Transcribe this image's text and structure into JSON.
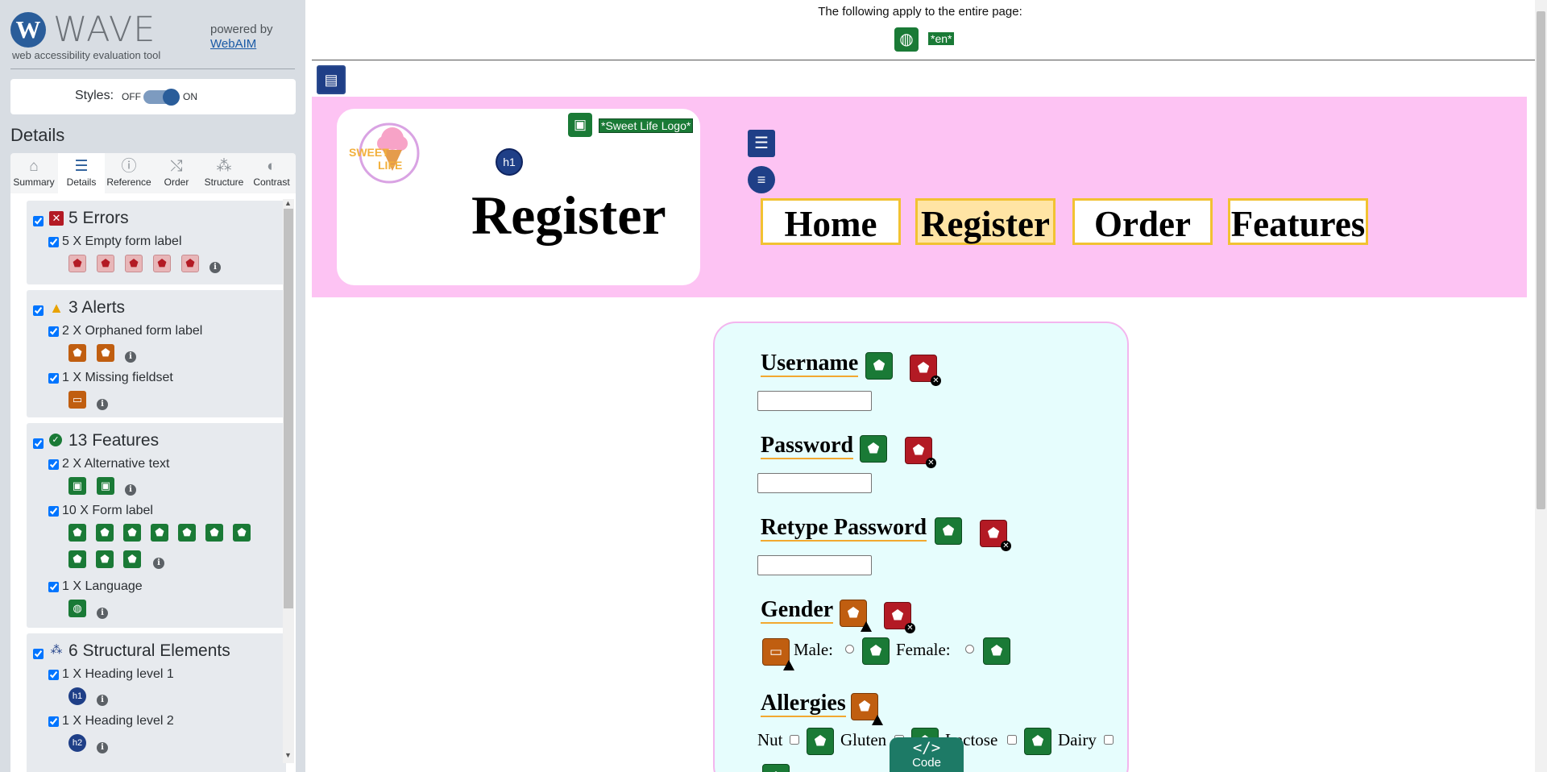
{
  "wave": {
    "title": "WAVE",
    "logo_letter": "W",
    "subtitle": "web accessibility evaluation tool",
    "powered_by": "powered by",
    "webaim": "WebAIM",
    "styles_label": "Styles:",
    "styles_off": "OFF",
    "styles_on": "ON",
    "details_heading": "Details",
    "tabs": [
      {
        "label": "Summary",
        "icon": "home-icon"
      },
      {
        "label": "Details",
        "icon": "list-icon"
      },
      {
        "label": "Reference",
        "icon": "info-icon"
      },
      {
        "label": "Order",
        "icon": "order-icon"
      },
      {
        "label": "Structure",
        "icon": "structure-icon"
      },
      {
        "label": "Contrast",
        "icon": "contrast-icon"
      }
    ],
    "sections": {
      "errors": {
        "title": "5 Errors",
        "items": [
          {
            "label": "5 X Empty form label"
          }
        ]
      },
      "alerts": {
        "title": "3 Alerts",
        "items": [
          {
            "label": "2 X Orphaned form label"
          },
          {
            "label": "1 X Missing fieldset"
          }
        ]
      },
      "features": {
        "title": "13 Features",
        "items": [
          {
            "label": "2 X Alternative text"
          },
          {
            "label": "10 X Form label"
          },
          {
            "label": "1 X Language"
          }
        ]
      },
      "structure": {
        "title": "6 Structural Elements",
        "items": [
          {
            "label": "1 X Heading level 1"
          },
          {
            "label": "1 X Heading level 2"
          }
        ]
      }
    }
  },
  "page": {
    "apply_text": "The following apply to the entire page:",
    "lang_tag": "*en*",
    "logo_alt": "*Sweet Life Logo*",
    "h1_badge": "h1",
    "title": "Register",
    "nav": [
      "Home",
      "Register",
      "Order",
      "Features"
    ],
    "form": {
      "username": "Username",
      "password": "Password",
      "retype_password": "Retype Password",
      "gender": "Gender",
      "male": "Male:",
      "female": "Female:",
      "allergies": "Allergies",
      "nut": "Nut",
      "gluten": "Gluten",
      "lactose": "Lactose",
      "dairy": "Dairy"
    },
    "code_button": "Code",
    "code_glyph": "</>"
  },
  "colors": {
    "header_band": "#fdc3f3",
    "form_bg": "#e6fdfd",
    "feature_green": "#1a7a36",
    "error_red": "#b31a24",
    "alert_orange": "#c05e10",
    "structure_blue": "#1f3f87",
    "nav_border": "#f2c232"
  }
}
